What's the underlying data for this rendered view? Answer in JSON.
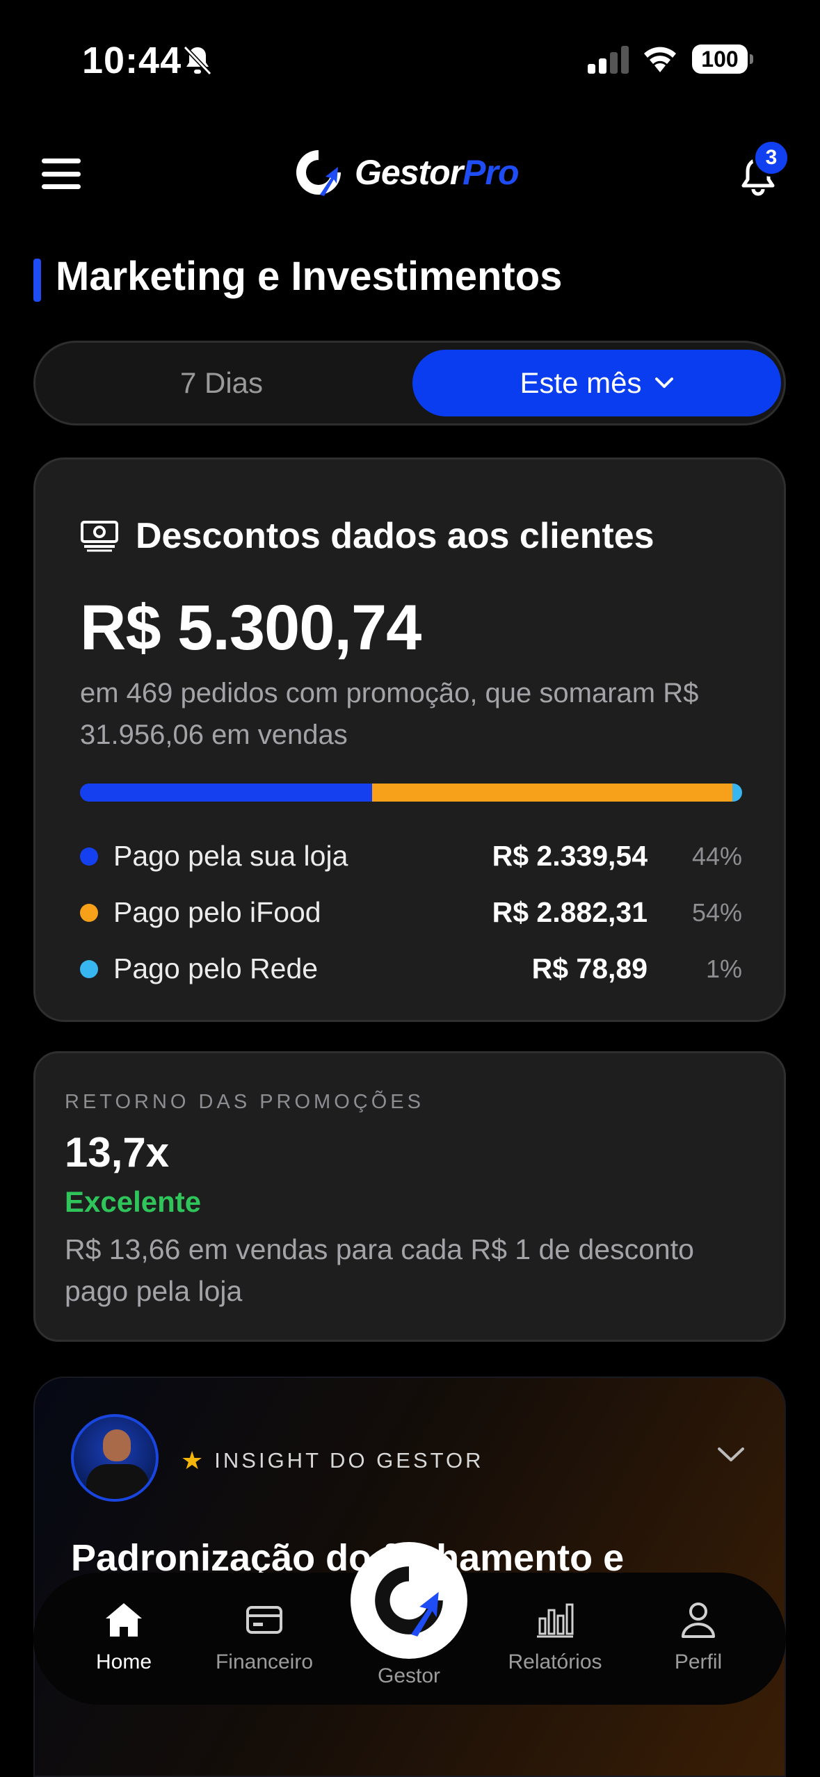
{
  "status_bar": {
    "time": "10:44",
    "battery": "100"
  },
  "header": {
    "logo_main": "Gestor",
    "logo_accent": "Pro",
    "notification_count": "3"
  },
  "page": {
    "title": "Marketing e Investimentos"
  },
  "period_selector": {
    "options": [
      "7 Dias",
      "Este mês"
    ],
    "selected": "Este mês"
  },
  "discounts": {
    "title": "Descontos dados aos clientes",
    "total": "R$ 5.300,74",
    "description": "em 469 pedidos com promoção, que somaram R$ 31.956,06 em vendas",
    "breakdown": [
      {
        "label": "Pago pela sua loja",
        "value": "R$ 2.339,54",
        "percent": "44%",
        "share": 44.1,
        "color": "#1440f0"
      },
      {
        "label": "Pago pelo iFood",
        "value": "R$ 2.882,31",
        "percent": "54%",
        "share": 54.4,
        "color": "#f7a11a"
      },
      {
        "label": "Pago pelo Rede",
        "value": "R$ 78,89",
        "percent": "1%",
        "share": 1.5,
        "color": "#38b6f0"
      }
    ]
  },
  "promo_return": {
    "label": "RETORNO DAS PROMOÇÕES",
    "value": "13,7x",
    "status": "Excelente",
    "description": "R$ 13,66 em vendas para cada R$ 1 de desconto pago pela loja"
  },
  "insight": {
    "label": "INSIGHT DO GESTOR",
    "title": "Padronização do fechamento e"
  },
  "bottom_nav": {
    "items": [
      "Home",
      "Financeiro",
      "Gestor",
      "Relatórios",
      "Perfil"
    ],
    "active": "Home"
  },
  "icons": [
    "menu-icon",
    "notification-bell-icon",
    "cash-icon",
    "star-icon",
    "chevron-down-icon",
    "home-icon",
    "card-icon",
    "bar-chart-icon",
    "user-icon"
  ]
}
